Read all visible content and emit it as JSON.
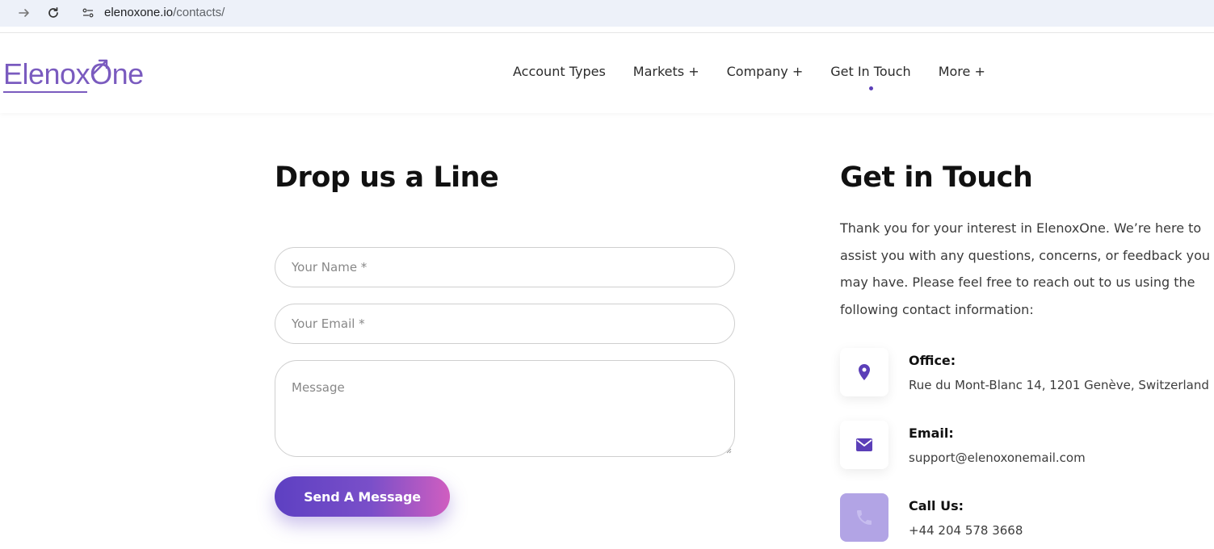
{
  "browser": {
    "url_domain": "elenoxone.io",
    "url_path": "/contacts/"
  },
  "header": {
    "logo_text": "ElenoxOne",
    "nav": [
      {
        "label": "Account Types"
      },
      {
        "label": "Markets +"
      },
      {
        "label": "Company +"
      },
      {
        "label": "Get In Touch"
      },
      {
        "label": "More +"
      }
    ],
    "active_nav": "Get In Touch"
  },
  "form": {
    "title": "Drop us a Line",
    "name_placeholder": "Your Name *",
    "email_placeholder": "Your Email *",
    "message_placeholder": "Message",
    "submit_label": "Send A Message"
  },
  "contact": {
    "title": "Get in Touch",
    "intro": "Thank you for your interest in ElenoxOne. We’re here to assist you with any questions, concerns, or feedback you may have. Please feel free to reach out to us using the following contact information:",
    "office_label": "Office:",
    "office_value": "Rue du Mont-Blanc 14, 1201 Genève, Switzerland",
    "email_label": "Email:",
    "email_value": "support@elenoxonemail.com",
    "phone_label": "Call Us:",
    "phone_value": "+44 204 578 3668"
  },
  "colors": {
    "brand": "#7a5bbf",
    "accent": "#5b3fb8",
    "button_gradient_end": "#d05ec0"
  },
  "icons": [
    "forward-arrow-icon",
    "reload-icon",
    "site-info-icon",
    "location-pin-icon",
    "envelope-icon",
    "phone-icon"
  ]
}
